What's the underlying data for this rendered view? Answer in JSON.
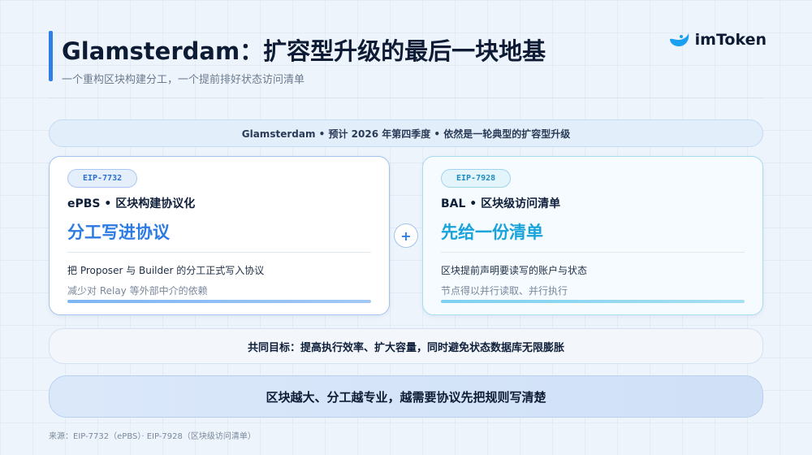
{
  "header": {
    "title": "Glamsterdam：扩容型升级的最后一块地基",
    "subtitle": "一个重构区块构建分工，一个提前排好状态访问清单",
    "logo_text": "imToken"
  },
  "top_banner": "Glamsterdam • 预计 2026 年第四季度 • 依然是一轮典型的扩容型升级",
  "cards": [
    {
      "badge": "EIP-7732",
      "subtitle": "ePBS • 区块构建协议化",
      "headline": "分工写进协议",
      "line1": "把 Proposer 与 Builder 的分工正式写入协议",
      "line2": "减少对 Relay 等外部中介的依赖"
    },
    {
      "badge": "EIP-7928",
      "subtitle": "BAL • 区块级访问清单",
      "headline": "先给一份清单",
      "line1": "区块提前声明要读写的账户与状态",
      "line2": "节点得以并行读取、并行执行"
    }
  ],
  "plus_symbol": "+",
  "goal": "共同目标：提高执行效率、扩大容量，同时避免状态数据库无限膨胀",
  "conclusion": "区块越大、分工越专业，越需要协议先把规则写清楚",
  "source": "来源：EIP-7732（ePBS）· EIP-7928（区块级访问清单）",
  "colors": {
    "accent_blue": "#2b7be3",
    "accent_cyan": "#19a3db",
    "title_bar": "#2f7fe8"
  },
  "icons": {
    "logo": "imtoken-logo-icon"
  }
}
